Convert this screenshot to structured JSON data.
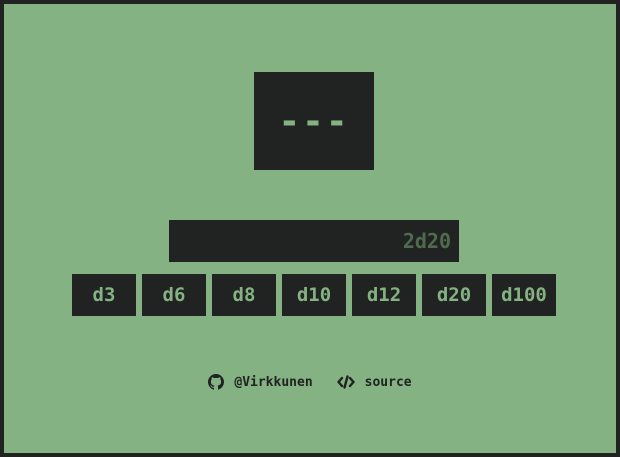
{
  "result": {
    "display": "---"
  },
  "roll_input": {
    "value": "",
    "placeholder": "2d20"
  },
  "dice": [
    {
      "label": "d3"
    },
    {
      "label": "d6"
    },
    {
      "label": "d8"
    },
    {
      "label": "d10"
    },
    {
      "label": "d12"
    },
    {
      "label": "d20"
    },
    {
      "label": "d100"
    }
  ],
  "footer": {
    "github_label": "@Virkkunen",
    "github_icon": "github-icon",
    "source_label": "source",
    "source_icon": "code-icon"
  },
  "colors": {
    "background": "#84b282",
    "frame": "#212322",
    "panel": "#212322",
    "accent": "#84b282",
    "placeholder": "#4f6b4e"
  }
}
